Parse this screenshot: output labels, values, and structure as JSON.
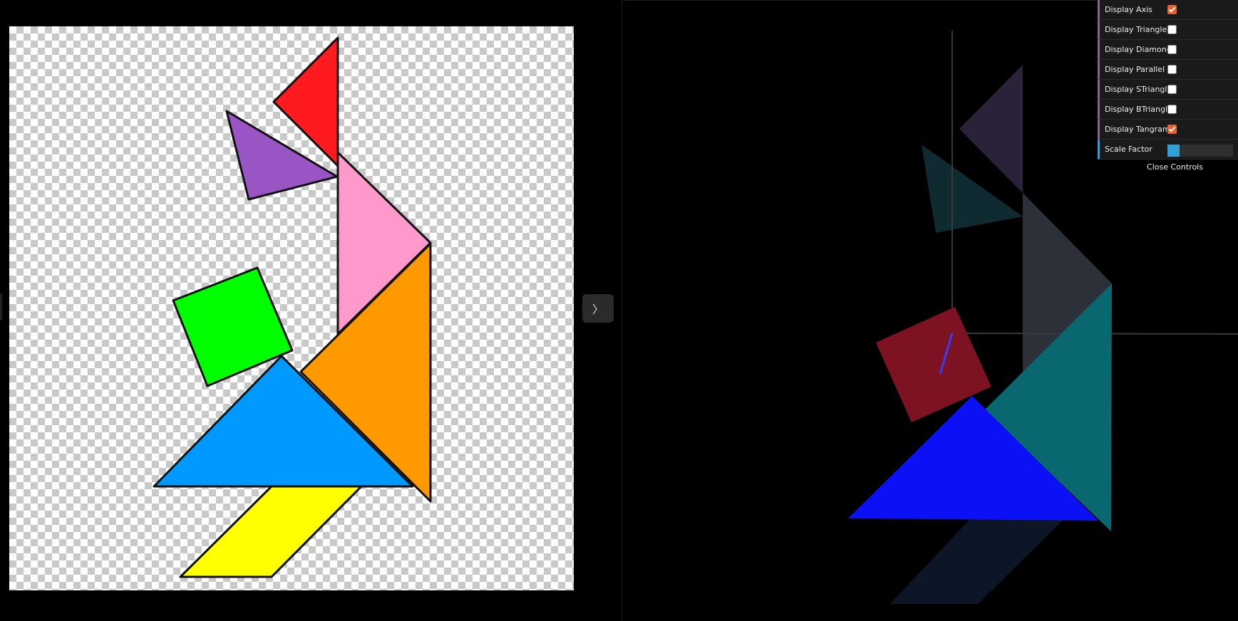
{
  "controls": {
    "items": [
      {
        "label": "Display Axis",
        "checked": true
      },
      {
        "label": "Display Triangle",
        "checked": false
      },
      {
        "label": "Display Diamond",
        "checked": false
      },
      {
        "label": "Display Parallel",
        "checked": false
      },
      {
        "label": "Display STriangle",
        "checked": false
      },
      {
        "label": "Display BTriangle",
        "checked": false
      },
      {
        "label": "Display Tangram",
        "checked": true
      }
    ],
    "scale_factor": {
      "label": "Scale Factor",
      "value_fraction": 0.18
    },
    "close_label": "Close Controls"
  },
  "collapse_button": {
    "icon": "chevron-right-icon",
    "glyph": "〉"
  },
  "colors": {
    "red": "#ff1a1f",
    "purple": "#9a55c4",
    "pink": "#ff99cc",
    "green": "#00ff00",
    "orange": "#ff9900",
    "blue_light": "#0099ff",
    "yellow": "#ffff00",
    "checkbox_accent": "#e8602c",
    "slider_accent": "#2fa1d6",
    "folder_accent": "#806787"
  }
}
